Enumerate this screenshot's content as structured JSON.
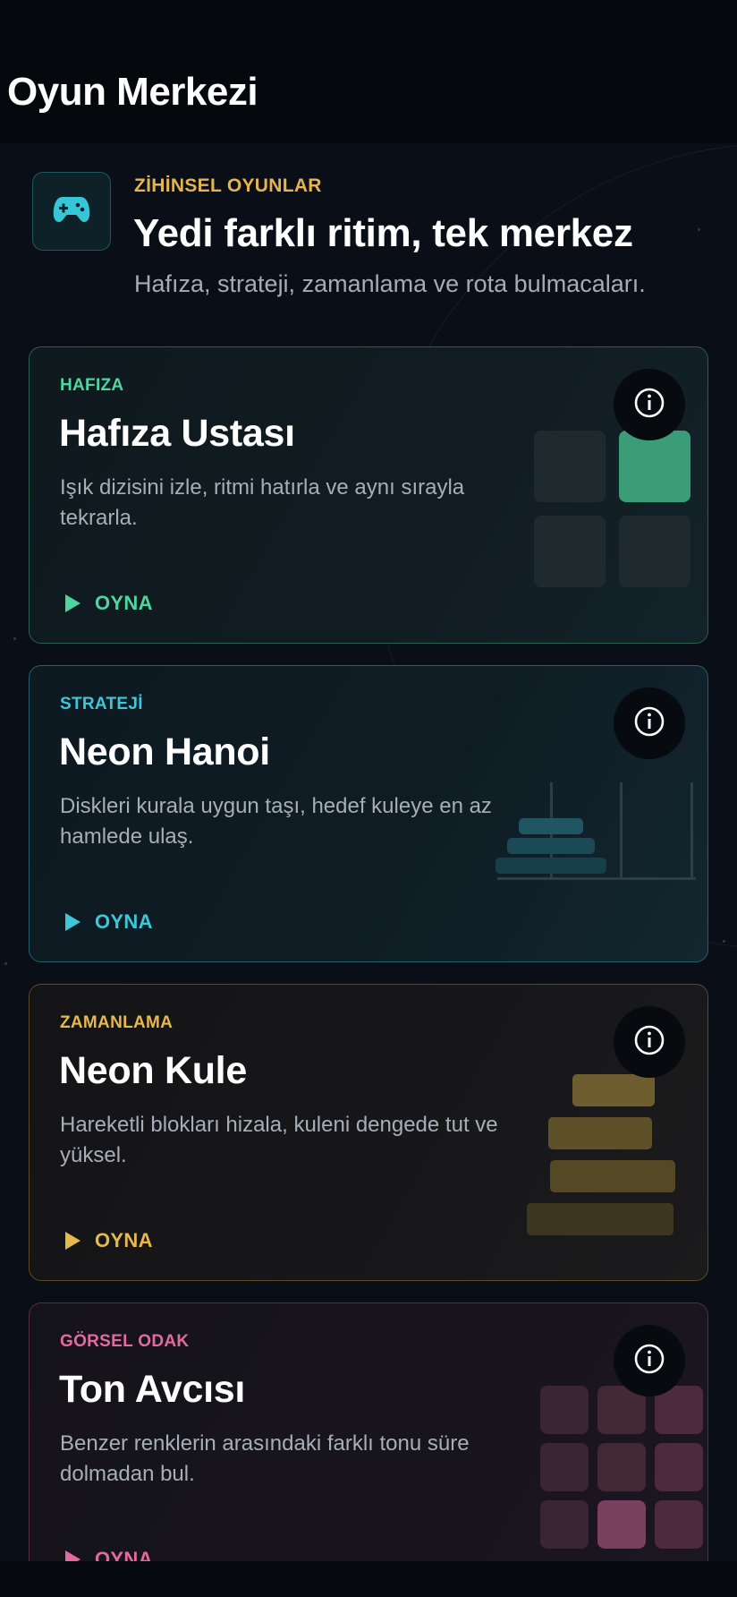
{
  "app": {
    "title": "Oyun Merkezi"
  },
  "hero": {
    "icon": "gamepad-icon",
    "eyebrow": "ZİHİNSEL OYUNLAR",
    "title": "Yedi farklı ritim, tek merkez",
    "subtitle": "Hafıza, strateji, zamanlama ve rota bulmacaları."
  },
  "cards": [
    {
      "category": "HAFIZA",
      "title": "Hafıza Ustası",
      "description": "Işık dizisini izle, ritmi hatırla ve aynı sırayla tekrarla.",
      "play_label": "OYNA",
      "accent": "#4fd5a0",
      "info_icon": "info-icon"
    },
    {
      "category": "STRATEJİ",
      "title": "Neon Hanoi",
      "description": "Diskleri kurala uygun taşı, hedef kuleye en az hamlede ulaş.",
      "play_label": "OYNA",
      "accent": "#3ec7d9",
      "info_icon": "info-icon"
    },
    {
      "category": "ZAMANLAMA",
      "title": "Neon Kule",
      "description": "Hareketli blokları hizala, kuleni dengede tut ve yüksel.",
      "play_label": "OYNA",
      "accent": "#e5b94c",
      "info_icon": "info-icon"
    },
    {
      "category": "GÖRSEL ODAK",
      "title": "Ton Avcısı",
      "description": "Benzer renklerin arasındaki farklı tonu süre dolmadan bul.",
      "play_label": "OYNA",
      "accent": "#e36aa0",
      "info_icon": "info-icon"
    }
  ],
  "colors": {
    "background": "#0a0f17",
    "topbar": "#04070b",
    "hero_eyebrow": "#e3b450",
    "muted_text": "#a6aeb9"
  }
}
